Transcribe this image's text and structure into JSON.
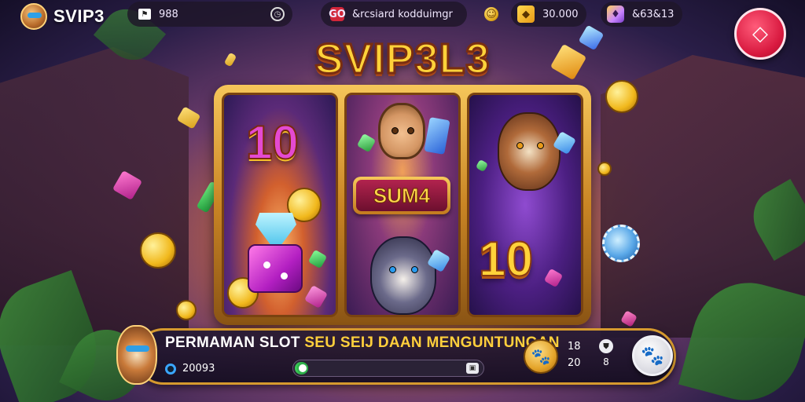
{
  "brand": {
    "title": "SVIP3",
    "avatar_icon": "fox-mascot-icon"
  },
  "topbar": {
    "pill_a": {
      "icon": "flag-icon",
      "value": "988",
      "secondary_icon": "clock-icon"
    },
    "pill_b": {
      "icon": "badge-icon",
      "icon_text": "GO",
      "label": "&rcsiard kodduimgr"
    },
    "pill_c": {
      "icon": "coin-icon"
    },
    "pill_d": {
      "icon": "cube-icon",
      "value": "30.000"
    },
    "pill_e": {
      "icon": "gem-icon",
      "value": "&63&13"
    }
  },
  "close_button": {
    "icon": "close-diamond-icon",
    "glyph": "◇"
  },
  "game": {
    "title": "SVIP3L3",
    "reels": {
      "reel1": {
        "top_symbol": "10"
      },
      "reel2": {
        "badge": "SUM4"
      },
      "reel3": {
        "bottom_symbol": "10"
      }
    }
  },
  "bottom": {
    "title_white": "PERMAMAN SLOT",
    "title_gold": "SEU SEIJ DAAN MENGUNTUNGAN",
    "sub_value": "20093",
    "progress": 0.07,
    "progress_end_icon": "ticket-icon",
    "bet_icon": "paw-icon",
    "stat_top": "18",
    "stat_bottom": "20",
    "stat2_top_icon": "shield-icon",
    "stat2_bottom": "8",
    "spin_icon": "paw-icon"
  },
  "colors": {
    "accent_gold": "#ffd23a",
    "close_red": "#d8193f",
    "progress_green": "#3ed25a",
    "panel_border": "#d69a2e"
  }
}
